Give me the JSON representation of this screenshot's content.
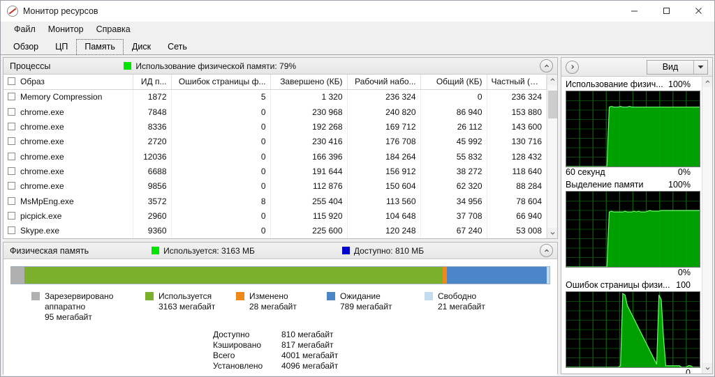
{
  "window": {
    "title": "Монитор ресурсов",
    "icon": "resource-monitor-icon",
    "minimize": "–",
    "maximize": "□",
    "close": "✕"
  },
  "menubar": {
    "items": [
      {
        "label": "Файл"
      },
      {
        "label": "Монитор"
      },
      {
        "label": "Справка"
      }
    ]
  },
  "tabs": [
    {
      "label": "Обзор",
      "active": false
    },
    {
      "label": "ЦП",
      "active": false
    },
    {
      "label": "Память",
      "active": true
    },
    {
      "label": "Диск",
      "active": false
    },
    {
      "label": "Сеть",
      "active": false
    }
  ],
  "processes": {
    "title": "Процессы",
    "status_label": "Использование физической памяти: 79%",
    "status_swatch_color": "#00e400",
    "collapse_icon": "chevron-up-icon",
    "columns": [
      {
        "key": "image",
        "label": "Образ",
        "align": "left"
      },
      {
        "key": "pid",
        "label": "ИД п...",
        "align": "right"
      },
      {
        "key": "faults",
        "label": "Ошибок страницы ф...",
        "align": "right"
      },
      {
        "key": "commit",
        "label": "Завершено (КБ)",
        "align": "right"
      },
      {
        "key": "working",
        "label": "Рабочий набо...",
        "align": "right"
      },
      {
        "key": "shareable",
        "label": "Общий (КБ)",
        "align": "right"
      },
      {
        "key": "private",
        "label": "Частный (КБ)",
        "align": "right"
      }
    ],
    "rows": [
      {
        "image": "Memory Compression",
        "pid": "1872",
        "faults": "5",
        "commit": "1 320",
        "working": "236 324",
        "shareable": "0",
        "private": "236 324"
      },
      {
        "image": "chrome.exe",
        "pid": "7848",
        "faults": "0",
        "commit": "230 968",
        "working": "240 820",
        "shareable": "86 940",
        "private": "153 880"
      },
      {
        "image": "chrome.exe",
        "pid": "8336",
        "faults": "0",
        "commit": "192 268",
        "working": "169 712",
        "shareable": "26 112",
        "private": "143 600"
      },
      {
        "image": "chrome.exe",
        "pid": "2720",
        "faults": "0",
        "commit": "230 416",
        "working": "176 708",
        "shareable": "45 992",
        "private": "130 716"
      },
      {
        "image": "chrome.exe",
        "pid": "12036",
        "faults": "0",
        "commit": "166 396",
        "working": "184 264",
        "shareable": "55 832",
        "private": "128 432"
      },
      {
        "image": "chrome.exe",
        "pid": "6688",
        "faults": "0",
        "commit": "191 644",
        "working": "156 912",
        "shareable": "38 272",
        "private": "118 640"
      },
      {
        "image": "chrome.exe",
        "pid": "9856",
        "faults": "0",
        "commit": "112 876",
        "working": "150 604",
        "shareable": "62 320",
        "private": "88 284"
      },
      {
        "image": "MsMpEng.exe",
        "pid": "3572",
        "faults": "8",
        "commit": "255 404",
        "working": "113 560",
        "shareable": "34 956",
        "private": "78 604"
      },
      {
        "image": "picpick.exe",
        "pid": "2960",
        "faults": "0",
        "commit": "115 920",
        "working": "104 648",
        "shareable": "37 708",
        "private": "66 940"
      },
      {
        "image": "Skype.exe",
        "pid": "9360",
        "faults": "0",
        "commit": "225 600",
        "working": "120 248",
        "shareable": "67 240",
        "private": "53 008"
      }
    ]
  },
  "physical_memory": {
    "title": "Физическая память",
    "used_label": "Используется: 3163 МБ",
    "used_swatch_color": "#00e400",
    "available_label": "Доступно: 810 МБ",
    "available_swatch_color": "#0000cc",
    "collapse_icon": "chevron-up-icon",
    "bar_segments": [
      {
        "name": "hardware-reserved",
        "color": "#b0b0b0",
        "percent": 2.4
      },
      {
        "name": "in-use",
        "color": "#7bb02c",
        "percent": 77.8
      },
      {
        "name": "modified",
        "color": "#ef8a1a",
        "percent": 0.7
      },
      {
        "name": "standby",
        "color": "#4a86c8",
        "percent": 18.6
      },
      {
        "name": "free",
        "color": "#c5dcef",
        "percent": 0.5
      }
    ],
    "legend": [
      {
        "name": "hardware-reserved",
        "color": "#b0b0b0",
        "label": "Зарезервировано аппаратно",
        "value": "95 мегабайт"
      },
      {
        "name": "in-use",
        "color": "#7bb02c",
        "label": "Используется",
        "value": "3163 мегабайт"
      },
      {
        "name": "modified",
        "color": "#ef8a1a",
        "label": "Изменено",
        "value": "28 мегабайт"
      },
      {
        "name": "standby",
        "color": "#4a86c8",
        "label": "Ожидание",
        "value": "789 мегабайт"
      },
      {
        "name": "free",
        "color": "#c5dcef",
        "label": "Свободно",
        "value": "21 мегабайт"
      }
    ],
    "stats": [
      {
        "label": "Доступно",
        "value": "810 мегабайт"
      },
      {
        "label": "Кэшировано",
        "value": "817 мегабайт"
      },
      {
        "label": "Всего",
        "value": "4001 мегабайт"
      },
      {
        "label": "Установлено",
        "value": "4096 мегабайт"
      }
    ]
  },
  "right_panel": {
    "expand_icon": "chevron-right-icon",
    "view_button_label": "Вид",
    "view_dropdown_icon": "chevron-down-icon",
    "charts": [
      {
        "name": "Использование физич...",
        "max_label": "100%",
        "bottom_left": "60 секунд",
        "bottom_right": "0%",
        "series_color": "#00c000",
        "line_color": "#5aff5a",
        "points": [
          0,
          0,
          0,
          0,
          0,
          0,
          0,
          0,
          0,
          0,
          0,
          0,
          0,
          0,
          0,
          0,
          0,
          0,
          0,
          79,
          80,
          79,
          79,
          79,
          80,
          79,
          79,
          79,
          80,
          79,
          79,
          79,
          79,
          79,
          79,
          79,
          79,
          79,
          79,
          79,
          79,
          79,
          79,
          79,
          79,
          79,
          79,
          79,
          79,
          79,
          79,
          79,
          79,
          79,
          79,
          79,
          79,
          79,
          79,
          79
        ]
      },
      {
        "name": "Выделение памяти",
        "max_label": "100%",
        "bottom_left": "",
        "bottom_right": "0%",
        "series_color": "#00c000",
        "line_color": "#5aff5a",
        "points": [
          0,
          0,
          0,
          0,
          0,
          0,
          0,
          0,
          0,
          0,
          0,
          0,
          0,
          0,
          0,
          0,
          0,
          0,
          0,
          73,
          74,
          73,
          73,
          73,
          73,
          73,
          74,
          73,
          73,
          73,
          74,
          73,
          74,
          73,
          73,
          73,
          74,
          75,
          74,
          74,
          74,
          74,
          75,
          75,
          75,
          75,
          75,
          75,
          75,
          75,
          75,
          75,
          75,
          75,
          75,
          75,
          75,
          75,
          75,
          75
        ]
      },
      {
        "name": "Ошибок страницы физи...",
        "max_label": "100",
        "bottom_left": "",
        "bottom_right": "0",
        "series_color": "#00c000",
        "line_color": "#5aff5a",
        "points": [
          0,
          0,
          0,
          0,
          0,
          0,
          0,
          0,
          0,
          0,
          0,
          0,
          0,
          0,
          0,
          0,
          0,
          0,
          0,
          0,
          0,
          0,
          0,
          0,
          2,
          98,
          96,
          82,
          76,
          70,
          64,
          58,
          52,
          46,
          40,
          34,
          28,
          22,
          16,
          10,
          4,
          96,
          90,
          40,
          2,
          2,
          2,
          2,
          2,
          2,
          2,
          0,
          0,
          0,
          2,
          2,
          0,
          0,
          0,
          0
        ]
      }
    ]
  },
  "chart_data": [
    {
      "type": "area",
      "title": "Использование физич...",
      "xlabel": "60 секунд",
      "ylabel": "%",
      "ylim": [
        0,
        100
      ],
      "ytick_labels": [
        "100%",
        "0%"
      ],
      "grid": true,
      "x": [
        0,
        1,
        2,
        3,
        4,
        5,
        6,
        7,
        8,
        9,
        10,
        11,
        12,
        13,
        14,
        15,
        16,
        17,
        18,
        19,
        20,
        21,
        22,
        23,
        24,
        25,
        26,
        27,
        28,
        29,
        30,
        31,
        32,
        33,
        34,
        35,
        36,
        37,
        38,
        39,
        40,
        41,
        42,
        43,
        44,
        45,
        46,
        47,
        48,
        49,
        50,
        51,
        52,
        53,
        54,
        55,
        56,
        57,
        58,
        59
      ],
      "values": [
        0,
        0,
        0,
        0,
        0,
        0,
        0,
        0,
        0,
        0,
        0,
        0,
        0,
        0,
        0,
        0,
        0,
        0,
        0,
        79,
        80,
        79,
        79,
        79,
        80,
        79,
        79,
        79,
        80,
        79,
        79,
        79,
        79,
        79,
        79,
        79,
        79,
        79,
        79,
        79,
        79,
        79,
        79,
        79,
        79,
        79,
        79,
        79,
        79,
        79,
        79,
        79,
        79,
        79,
        79,
        79,
        79,
        79,
        79,
        79
      ]
    },
    {
      "type": "area",
      "title": "Выделение памяти",
      "xlabel": "",
      "ylabel": "%",
      "ylim": [
        0,
        100
      ],
      "ytick_labels": [
        "100%",
        "0%"
      ],
      "grid": true,
      "x": [
        0,
        1,
        2,
        3,
        4,
        5,
        6,
        7,
        8,
        9,
        10,
        11,
        12,
        13,
        14,
        15,
        16,
        17,
        18,
        19,
        20,
        21,
        22,
        23,
        24,
        25,
        26,
        27,
        28,
        29,
        30,
        31,
        32,
        33,
        34,
        35,
        36,
        37,
        38,
        39,
        40,
        41,
        42,
        43,
        44,
        45,
        46,
        47,
        48,
        49,
        50,
        51,
        52,
        53,
        54,
        55,
        56,
        57,
        58,
        59
      ],
      "values": [
        0,
        0,
        0,
        0,
        0,
        0,
        0,
        0,
        0,
        0,
        0,
        0,
        0,
        0,
        0,
        0,
        0,
        0,
        0,
        73,
        74,
        73,
        73,
        73,
        73,
        73,
        74,
        73,
        73,
        73,
        74,
        73,
        74,
        73,
        73,
        73,
        74,
        75,
        74,
        74,
        74,
        74,
        75,
        75,
        75,
        75,
        75,
        75,
        75,
        75,
        75,
        75,
        75,
        75,
        75,
        75,
        75,
        75,
        75,
        75
      ]
    },
    {
      "type": "area",
      "title": "Ошибок страницы физи...",
      "xlabel": "",
      "ylabel": "",
      "ylim": [
        0,
        100
      ],
      "ytick_labels": [
        "100",
        "0"
      ],
      "grid": true,
      "x": [
        0,
        1,
        2,
        3,
        4,
        5,
        6,
        7,
        8,
        9,
        10,
        11,
        12,
        13,
        14,
        15,
        16,
        17,
        18,
        19,
        20,
        21,
        22,
        23,
        24,
        25,
        26,
        27,
        28,
        29,
        30,
        31,
        32,
        33,
        34,
        35,
        36,
        37,
        38,
        39,
        40,
        41,
        42,
        43,
        44,
        45,
        46,
        47,
        48,
        49,
        50,
        51,
        52,
        53,
        54,
        55,
        56,
        57,
        58,
        59
      ],
      "values": [
        0,
        0,
        0,
        0,
        0,
        0,
        0,
        0,
        0,
        0,
        0,
        0,
        0,
        0,
        0,
        0,
        0,
        0,
        0,
        0,
        0,
        0,
        0,
        0,
        2,
        98,
        96,
        82,
        76,
        70,
        64,
        58,
        52,
        46,
        40,
        34,
        28,
        22,
        16,
        10,
        4,
        96,
        90,
        40,
        2,
        2,
        2,
        2,
        2,
        2,
        2,
        0,
        0,
        0,
        2,
        2,
        0,
        0,
        0,
        0
      ]
    }
  ]
}
